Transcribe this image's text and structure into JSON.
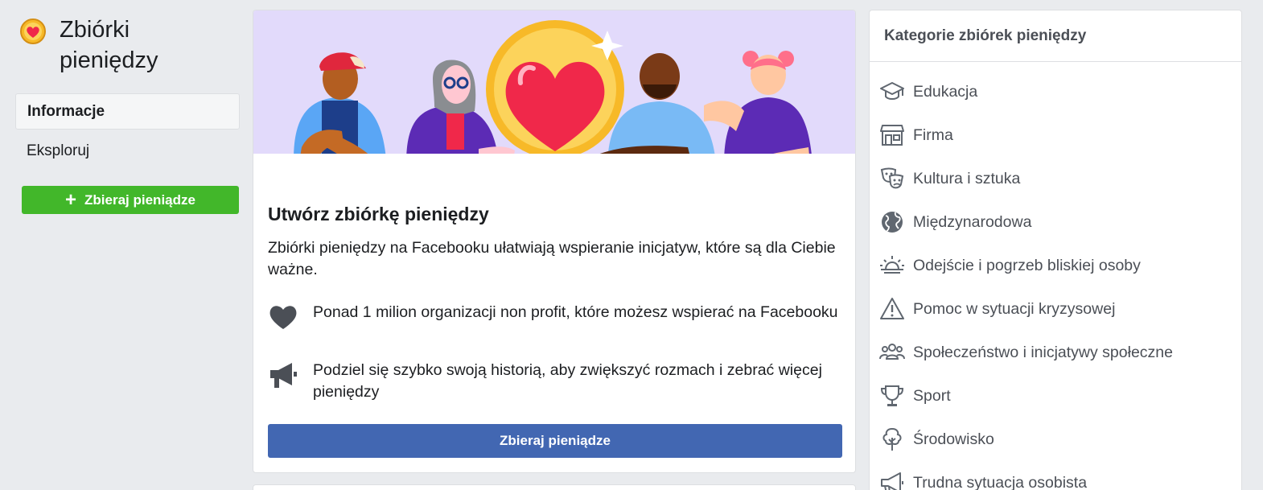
{
  "sidebar": {
    "title": "Zbiórki pieniędzy",
    "nav": [
      {
        "label": "Informacje",
        "active": true
      },
      {
        "label": "Eksploruj",
        "active": false
      }
    ],
    "create_button": "Zbieraj pieniądze"
  },
  "main": {
    "title": "Utwórz zbiórkę pieniędzy",
    "description": "Zbiórki pieniędzy na Facebooku ułatwiają wspieranie inicjatyw, które są dla Ciebie ważne.",
    "features": [
      {
        "icon": "heart-icon",
        "text": "Ponad 1 milion organizacji non profit, które możesz wspierać na Facebooku"
      },
      {
        "icon": "megaphone-icon",
        "text": "Podziel się szybko swoją historią, aby zwiększyć rozmach i zebrać więcej pieniędzy"
      }
    ],
    "button": "Zbieraj pieniądze"
  },
  "categories": {
    "title": "Kategorie zbiórek pieniędzy",
    "items": [
      {
        "label": "Edukacja",
        "icon": "graduation-cap-icon"
      },
      {
        "label": "Firma",
        "icon": "store-icon"
      },
      {
        "label": "Kultura i sztuka",
        "icon": "theater-masks-icon"
      },
      {
        "label": "Międzynarodowa",
        "icon": "globe-icon"
      },
      {
        "label": "Odejście i pogrzeb bliskiej osoby",
        "icon": "sunset-icon"
      },
      {
        "label": "Pomoc w sytuacji kryzysowej",
        "icon": "warning-icon"
      },
      {
        "label": "Społeczeństwo i inicjatywy społeczne",
        "icon": "people-group-icon"
      },
      {
        "label": "Sport",
        "icon": "trophy-icon"
      },
      {
        "label": "Środowisko",
        "icon": "tree-icon"
      },
      {
        "label": "Trudna sytuacja osobista",
        "icon": "megaphone-icon"
      }
    ]
  },
  "colors": {
    "green": "#42b72a",
    "blue": "#4267b2",
    "banner_bg": "#e2dafb",
    "heart_red": "#f0284a",
    "coin_yellow": "#f7b928"
  }
}
